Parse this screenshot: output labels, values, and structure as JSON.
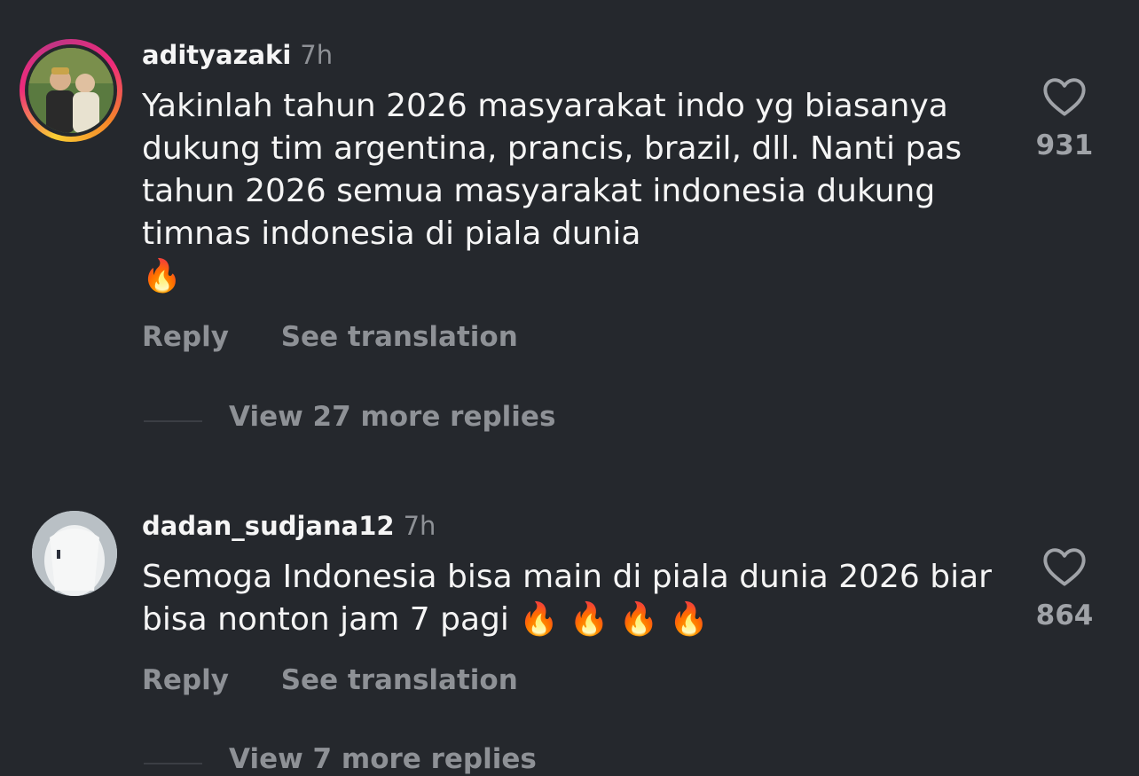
{
  "comments": [
    {
      "username": "adityazaki",
      "time": "7h",
      "text": "Yakinlah tahun 2026 masyarakat indo yg biasanya dukung tim argentina, prancis, brazil, dll. Nanti pas tahun 2026 semua masyarakat indonesia dukung timnas indonesia di piala dunia",
      "emoji": "🔥",
      "reply_label": "Reply",
      "translate_label": "See translation",
      "view_replies": "View 27 more replies",
      "likes": "931",
      "has_story_ring": true
    },
    {
      "username": "dadan_sudjana12",
      "time": "7h",
      "text": "Semoga Indonesia bisa main di piala dunia 2026 biar bisa nonton jam 7 pagi",
      "emoji": "🔥 🔥 🔥 🔥",
      "reply_label": "Reply",
      "translate_label": "See translation",
      "view_replies": "View 7 more replies",
      "likes": "864",
      "has_story_ring": false
    }
  ],
  "icons": {
    "like": "heart-outline-icon"
  },
  "colors": {
    "background": "#25282d",
    "primary_text": "#f5f5f5",
    "secondary_text": "#8e9196"
  }
}
